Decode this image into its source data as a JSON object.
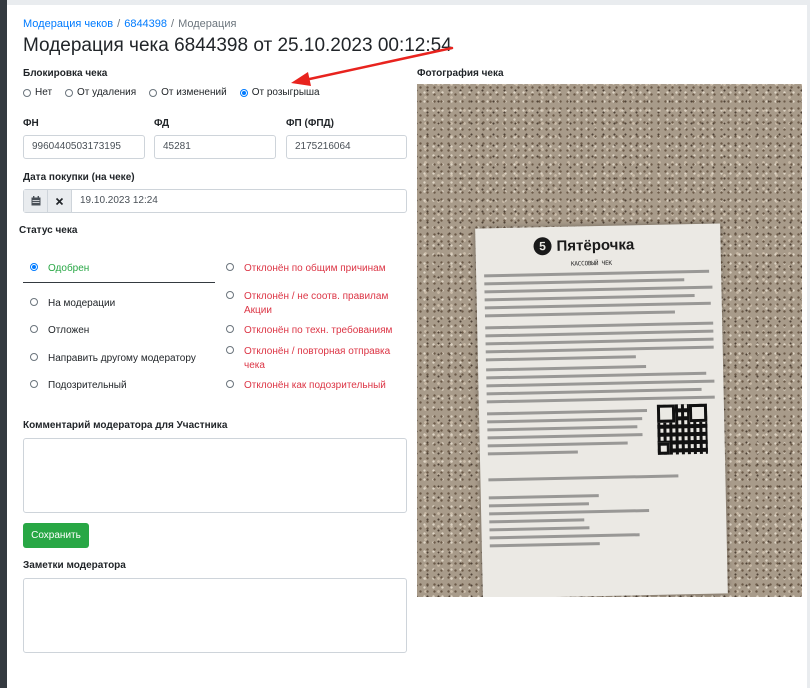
{
  "breadcrumb": {
    "items": [
      "Модерация чеков",
      "6844398",
      "Модерация"
    ],
    "separator": "/"
  },
  "page_title": "Модерация чека 6844398 от 25.10.2023 00:12:54",
  "lock": {
    "label": "Блокировка чека",
    "options": [
      "Нет",
      "От удаления",
      "От изменений",
      "От розыгрыша"
    ],
    "selected": "От розыгрыша"
  },
  "fields": {
    "fn": {
      "label": "ФН",
      "value": "9960440503173195"
    },
    "fd": {
      "label": "ФД",
      "value": "45281"
    },
    "fp": {
      "label": "ФП (ФПД)",
      "value": "2175216064"
    }
  },
  "purchase_date": {
    "label": "Дата покупки (на чеке)",
    "value": "19.10.2023 12:24",
    "calendar_icon": "calendar-icon",
    "clear_icon": "close-icon"
  },
  "status": {
    "label": "Статус чека",
    "selected": "Одобрен",
    "left": [
      "Одобрен",
      "На модерации",
      "Отложен",
      "Направить другому модератору",
      "Подозрительный"
    ],
    "right": [
      "Отклонён по общим причинам",
      "Отклонён / не соотв. правилам Акции",
      "Отклонён по техн. требованиям",
      "Отклонён / повторная отправка чека",
      "Отклонён как подозрительный"
    ]
  },
  "comment": {
    "label": "Комментарий модератора для Участника",
    "value": ""
  },
  "save_button": "Сохранить",
  "notes": {
    "label": "Заметки модератора",
    "value": ""
  },
  "photo": {
    "label": "Фотография чека",
    "brand": "Пятёрочка",
    "logo_digit": "5",
    "receipt_header": "КАССОВЫЙ ЧЕК"
  },
  "colors": {
    "link": "#007bff",
    "success": "#28a745",
    "danger": "#dc3545",
    "annotation_arrow": "#e8231e"
  }
}
